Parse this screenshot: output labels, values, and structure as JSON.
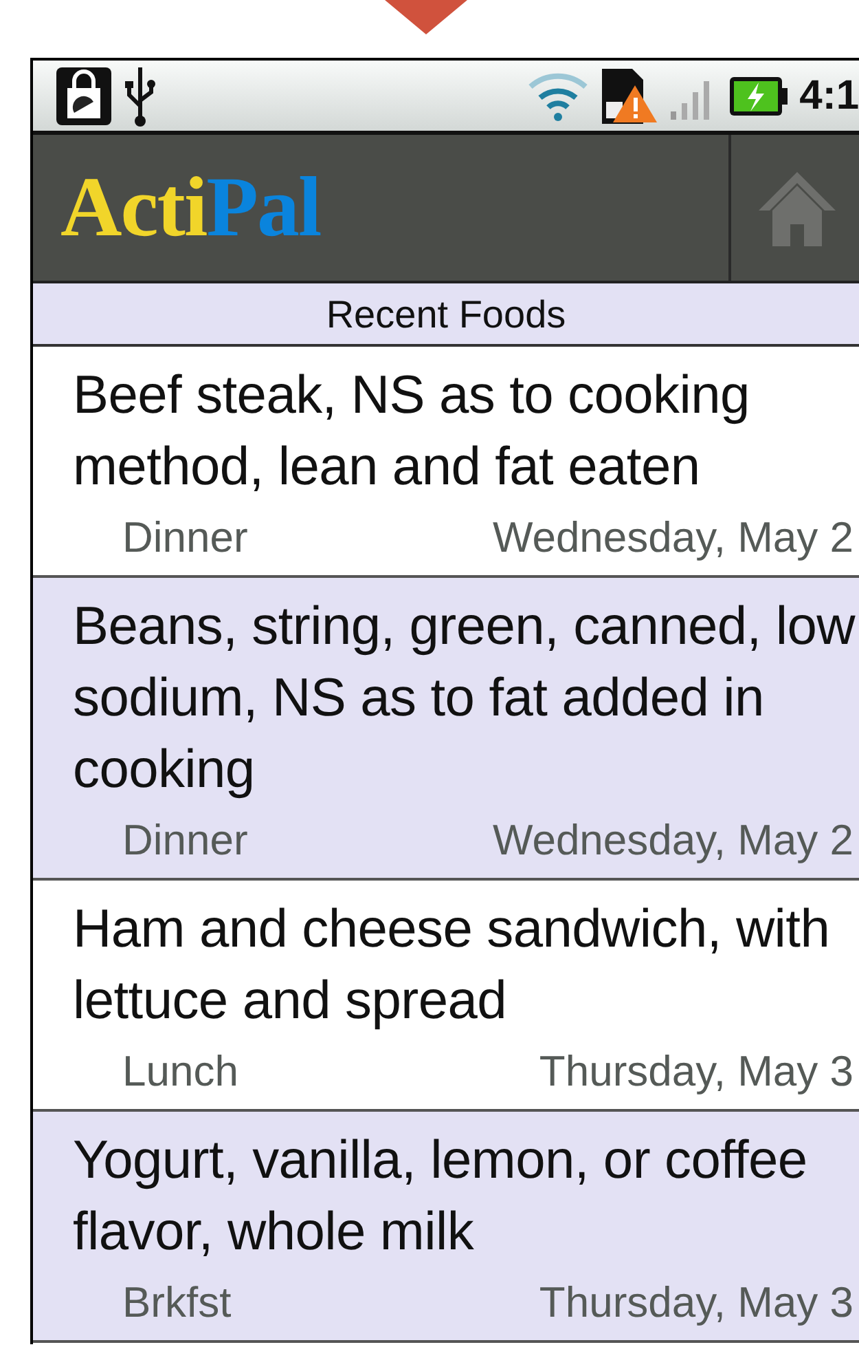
{
  "status_bar": {
    "time": "4:1"
  },
  "header": {
    "logo_first": "Acti",
    "logo_second": "Pal"
  },
  "list": {
    "title": "Recent Foods",
    "items": [
      {
        "food": "Beef steak, NS as to cooking method, lean and fat eaten",
        "meal": "Dinner",
        "date": "Wednesday, May 2"
      },
      {
        "food": "Beans, string, green, canned, low sodium, NS as to fat added in cooking",
        "meal": "Dinner",
        "date": "Wednesday, May 2"
      },
      {
        "food": "Ham and cheese sandwich, with lettuce and spread",
        "meal": "Lunch",
        "date": "Thursday, May 3"
      },
      {
        "food": "Yogurt, vanilla, lemon, or coffee flavor, whole milk",
        "meal": "Brkfst",
        "date": "Thursday, May 3"
      }
    ]
  }
}
